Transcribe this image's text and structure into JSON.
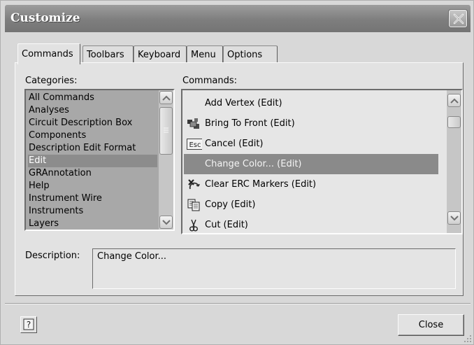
{
  "window": {
    "title": "Customize"
  },
  "tabs": [
    {
      "label": "Commands",
      "active": true
    },
    {
      "label": "Toolbars",
      "active": false
    },
    {
      "label": "Keyboard",
      "active": false
    },
    {
      "label": "Menu",
      "active": false
    },
    {
      "label": "Options",
      "active": false
    }
  ],
  "categories": {
    "label": "Categories:",
    "items": [
      "All Commands",
      "Analyses",
      "Circuit Description Box",
      "Components",
      "Description Edit Format",
      "Edit",
      "GRAnnotation",
      "Help",
      "Instrument Wire",
      "Instruments",
      "Layers"
    ],
    "selected": "Edit"
  },
  "commands": {
    "label": "Commands:",
    "items": [
      {
        "label": "Add Vertex (Edit)",
        "icon": "none"
      },
      {
        "label": "Bring To Front (Edit)",
        "icon": "bring-to-front-icon"
      },
      {
        "label": "Cancel (Edit)",
        "icon": "esc-key-icon",
        "icon_text": "Esc"
      },
      {
        "label": "Change Color... (Edit)",
        "icon": "none",
        "selected": true
      },
      {
        "label": "Clear ERC Markers (Edit)",
        "icon": "clear-erc-markers-icon"
      },
      {
        "label": "Copy (Edit)",
        "icon": "copy-icon"
      },
      {
        "label": "Cut (Edit)",
        "icon": "scissors-icon"
      }
    ]
  },
  "description": {
    "label": "Description:",
    "value": "Change Color..."
  },
  "buttons": {
    "help_icon": "?",
    "close_label": "Close"
  },
  "colors": {
    "selection": "#8a8a8a",
    "dialog": "#d8d8d8",
    "titlebar": "#7e7e7e"
  }
}
